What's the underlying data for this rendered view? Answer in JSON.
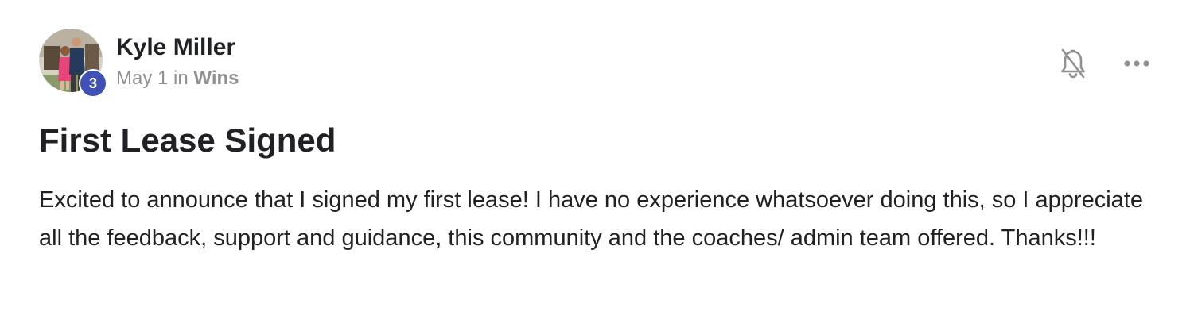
{
  "post": {
    "author": {
      "name": "Kyle Miller",
      "level": "3"
    },
    "meta": {
      "date": "May 1",
      "in_text": "in",
      "category": "Wins"
    },
    "title": "First Lease Signed",
    "body": "Excited to announce that I signed my first lease! I have no experience whatsoever doing this, so I appreciate all the feedback, support and guidance, this community and the coaches/ admin team offered. Thanks!!!"
  },
  "icons": {
    "notifications": "bell-off-icon",
    "more": "more-horizontal-icon"
  },
  "colors": {
    "level_badge": "#3f51b5",
    "text_primary": "#202124",
    "text_secondary": "#909090",
    "icon": "#909090"
  }
}
